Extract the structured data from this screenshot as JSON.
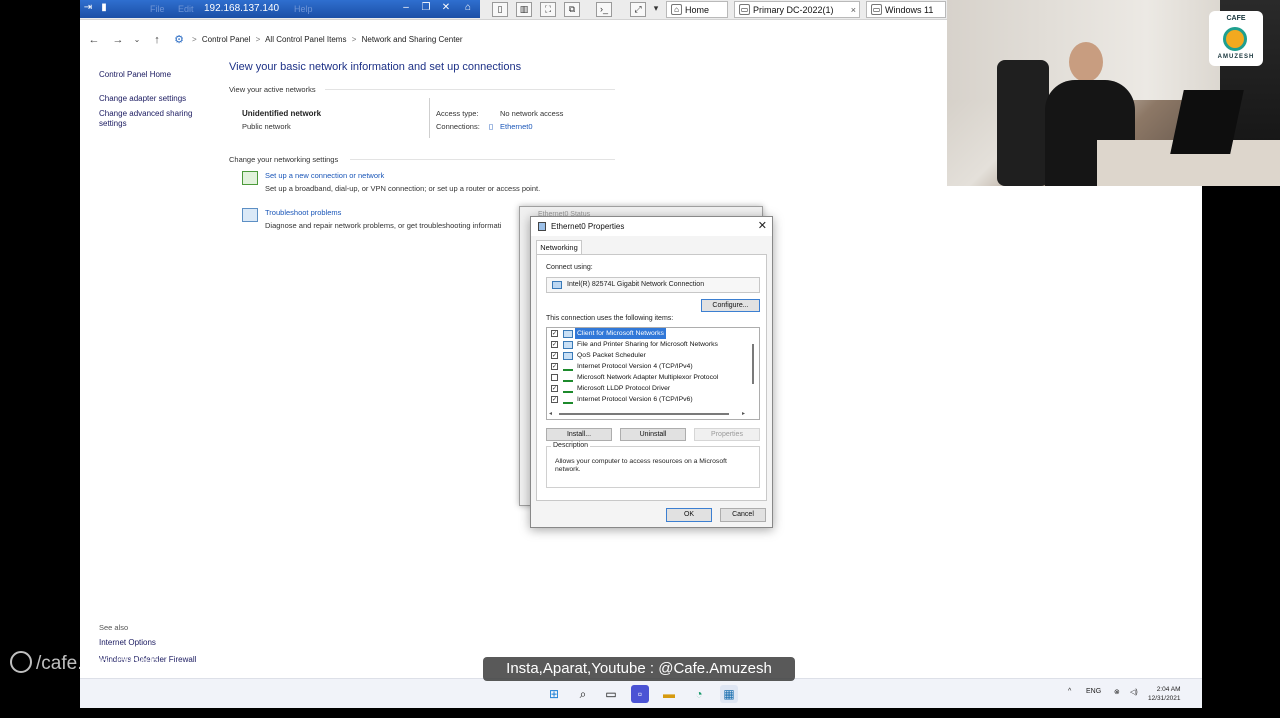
{
  "rdp_toolbar": {
    "connection_ip": "192.168.137.140",
    "ghost_menu": [
      "File",
      "Edit",
      "Help"
    ],
    "tabs": [
      {
        "label": "Home",
        "close": ""
      },
      {
        "label": "Primary DC-2022(1)",
        "close": "×"
      },
      {
        "label": "Windows 11",
        "close": ""
      }
    ]
  },
  "breadcrumb": {
    "items": [
      "Control Panel",
      "All Control Panel Items",
      "Network and Sharing Center"
    ],
    "separator": ">"
  },
  "left_pane": {
    "links": [
      "Control Panel Home",
      "Change adapter settings",
      "Change advanced sharing settings"
    ],
    "see_also_label": "See also",
    "see_also": [
      "Internet Options",
      "Windows Defender Firewall"
    ]
  },
  "main": {
    "title": "View your basic network information and set up connections",
    "active_networks_label": "View your active networks",
    "network_name": "Unidentified network",
    "network_type": "Public network",
    "access_type_label": "Access type:",
    "access_type_value": "No network access",
    "connections_label": "Connections:",
    "connections_value": "Ethernet0",
    "change_settings_label": "Change your networking settings",
    "setup_link": "Set up a new connection or network",
    "setup_desc": "Set up a broadband, dial-up, or VPN connection; or set up a router or access point.",
    "troubleshoot_link": "Troubleshoot problems",
    "troubleshoot_desc": "Diagnose and repair network problems, or get troubleshooting informati"
  },
  "status_dialog": {
    "title": "Ethernet0 Status"
  },
  "properties_dialog": {
    "title": "Ethernet0 Properties",
    "close": "✕",
    "tab": "Networking",
    "connect_using_label": "Connect using:",
    "adapter": "Intel(R) 82574L Gigabit Network Connection",
    "configure_button": "Configure...",
    "items_label": "This connection uses the following items:",
    "items": [
      {
        "name": "Client for Microsoft Networks",
        "checked": true,
        "selected": true,
        "icon": "network-client-icon"
      },
      {
        "name": "File and Printer Sharing for Microsoft Networks",
        "checked": true,
        "selected": false,
        "icon": "network-service-icon"
      },
      {
        "name": "QoS Packet Scheduler",
        "checked": true,
        "selected": false,
        "icon": "network-service-icon"
      },
      {
        "name": "Internet Protocol Version 4 (TCP/IPv4)",
        "checked": true,
        "selected": false,
        "icon": "protocol-icon"
      },
      {
        "name": "Microsoft Network Adapter Multiplexor Protocol",
        "checked": false,
        "selected": false,
        "icon": "protocol-icon"
      },
      {
        "name": "Microsoft LLDP Protocol Driver",
        "checked": true,
        "selected": false,
        "icon": "protocol-icon"
      },
      {
        "name": "Internet Protocol Version 6 (TCP/IPv6)",
        "checked": true,
        "selected": false,
        "icon": "protocol-icon"
      }
    ],
    "install_button": "Install...",
    "uninstall_button": "Uninstall",
    "properties_button": "Properties",
    "description_label": "Description",
    "description": "Allows your computer to access resources on a Microsoft network.",
    "ok_button": "OK",
    "cancel_button": "Cancel"
  },
  "taskbar": {
    "language": "ENG",
    "time": "2:04 AM",
    "date": "12/31/2021"
  },
  "watermarks": {
    "left": "/cafe.amuzesh",
    "center": "Insta,Aparat,Youtube : @Cafe.Amuzesh"
  },
  "logo": {
    "line1": "CAFE",
    "line2": "AMUZESH"
  },
  "colors": {
    "link_blue": "#1a56b8",
    "title_blue": "#1e3287",
    "selection": "#3178d8",
    "rdp_bar": "#2f6fcf"
  }
}
